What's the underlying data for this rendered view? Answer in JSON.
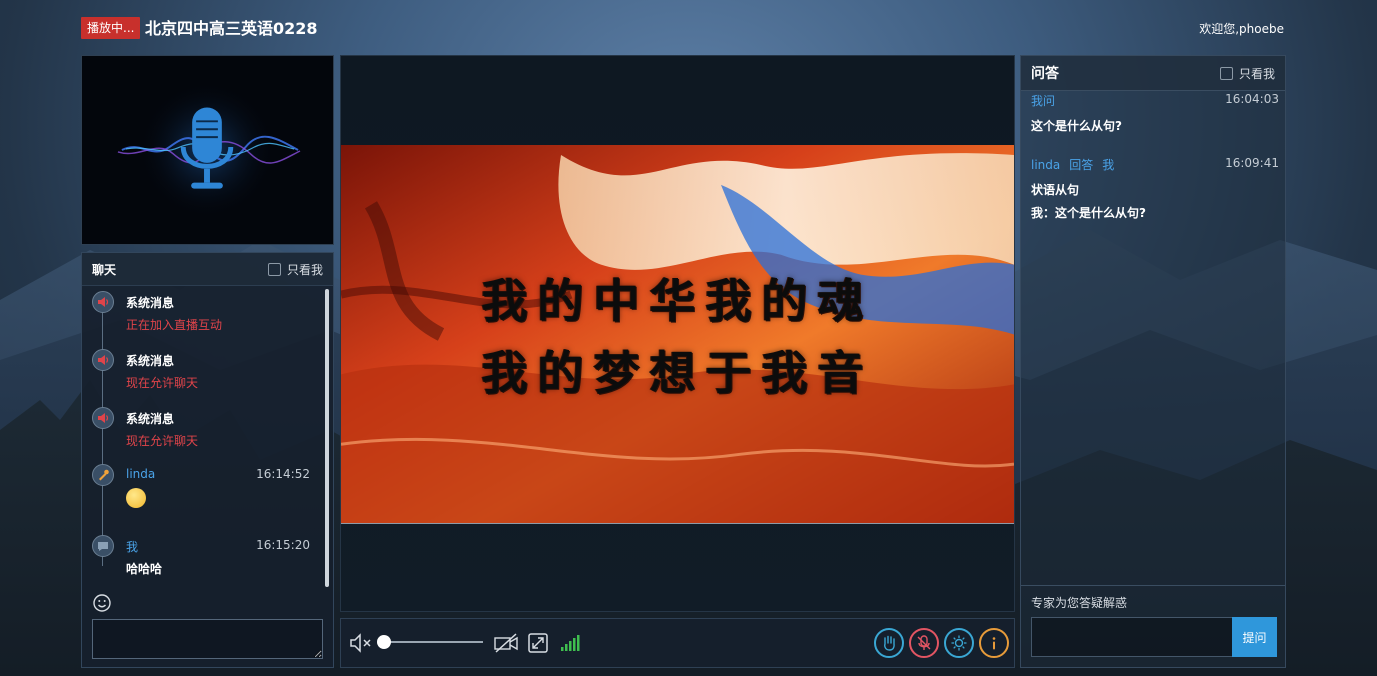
{
  "header": {
    "live_badge": "播放中...",
    "room_title": "北京四中高三英语0228",
    "welcome": "欢迎您,phoebe"
  },
  "chat": {
    "title": "聊天",
    "only_me_label": "只看我",
    "only_me_checked": false,
    "messages": [
      {
        "sender": "系统消息",
        "text": "正在加入直播互动",
        "time": "",
        "icon": "speaker-icon",
        "kind": "system"
      },
      {
        "sender": "系统消息",
        "text": "现在允许聊天",
        "time": "",
        "icon": "speaker-icon",
        "kind": "system"
      },
      {
        "sender": "系统消息",
        "text": "现在允许聊天",
        "time": "",
        "icon": "speaker-icon",
        "kind": "system"
      },
      {
        "sender": "linda",
        "text": "",
        "emoji": "smile-emoji",
        "time": "16:14:52",
        "icon": "teacher-icon",
        "kind": "user"
      },
      {
        "sender": "我",
        "text": "哈哈哈",
        "time": "16:15:20",
        "icon": "chat-bubble-icon",
        "kind": "user"
      }
    ],
    "input_placeholder": ""
  },
  "video": {
    "slide_line_1": "我的中华我的魂",
    "slide_line_2": "我的梦想于我音"
  },
  "controls": {
    "volume": 0,
    "muted": true,
    "icons": [
      "mute-icon",
      "camera-off-icon",
      "fullscreen-icon",
      "signal-icon",
      "raise-hand-icon",
      "mic-off-icon",
      "brightness-icon",
      "info-icon"
    ],
    "colors": {
      "hand": "#3aa7d4",
      "mic": "#e25563",
      "brightness": "#3aa7d4",
      "info": "#e79b3a",
      "signal": "#3fbf4f"
    }
  },
  "qa": {
    "title": "问答",
    "only_me_label": "只看我",
    "only_me_checked": false,
    "items": [
      {
        "from": [
          "我问"
        ],
        "time": "16:04:03",
        "lines": [
          "这个是什么从句?"
        ]
      },
      {
        "from": [
          "linda",
          "回答",
          "我"
        ],
        "time": "16:09:41",
        "lines": [
          "状语从句",
          "我：这个是什么从句?"
        ]
      }
    ],
    "hint": "专家为您答疑解惑",
    "input_placeholder": "",
    "submit_label": "提问"
  },
  "theme": {
    "live_red": "#c8302c",
    "link_blue": "#4aa3e8",
    "alert_red": "#e0444a",
    "submit_blue": "#2f97db"
  }
}
